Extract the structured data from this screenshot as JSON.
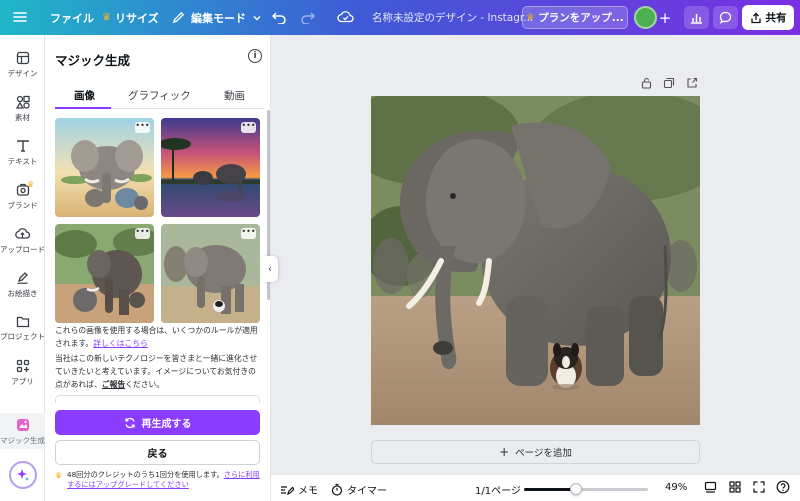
{
  "topbar": {
    "file_label": "ファイル",
    "resize_label": "リサイズ",
    "edit_mode_label": "編集モード",
    "document_title": "名称未設定のデザイン - Instagr...",
    "plan_label": "プランをアップ...",
    "share_label": "共有",
    "crown_color": "#f3b21c"
  },
  "rail": {
    "items": [
      {
        "label": "デザイン",
        "icon": "design-icon"
      },
      {
        "label": "素材",
        "icon": "elements-icon"
      },
      {
        "label": "テキスト",
        "icon": "text-icon"
      },
      {
        "label": "ブランド",
        "icon": "brand-icon"
      },
      {
        "label": "アップロード",
        "icon": "upload-icon"
      },
      {
        "label": "お絵描き",
        "icon": "draw-icon"
      },
      {
        "label": "プロジェクト",
        "icon": "folder-icon"
      },
      {
        "label": "アプリ",
        "icon": "apps-icon"
      },
      {
        "label": "マジック生成",
        "icon": "magic-media-icon"
      }
    ]
  },
  "panel": {
    "title": "マジック生成",
    "tabs": [
      "画像",
      "グラフィック",
      "動画"
    ],
    "active_tab": "画像",
    "rules_text": "これらの画像を使用する場合は、いくつかのルールが適用されます。",
    "rules_link": "詳しくはこちら",
    "tech_text": "当社はこの新しいテクノロジーを皆さまと一緒に進化させていきたいと考えています。イメージについてお気付きの点があれば、",
    "report_link": "ご報告",
    "tech_text_end": "ください。",
    "regenerate_label": "再生成する",
    "back_label": "戻る",
    "credits_text": "48回分のクレジットのうち1回分を使用します。",
    "credits_link": "さらに利用するにはアップグレードしてください",
    "accent_color": "#8b3dff"
  },
  "canvas": {
    "add_page_label": "ページを追加"
  },
  "bottombar": {
    "notes_label": "メモ",
    "timer_label": "タイマー",
    "page_indicator": "1/1ページ",
    "zoom_label": "49%",
    "zoom_fraction": 0.42
  }
}
